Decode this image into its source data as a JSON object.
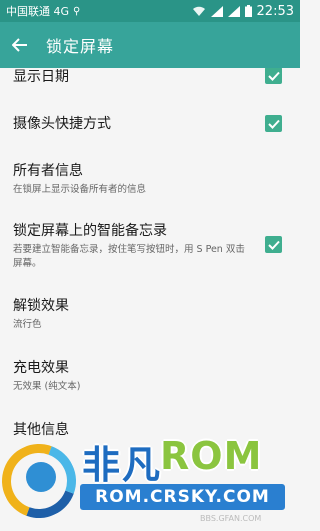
{
  "status_bar": {
    "carrier": "中国联通 4G",
    "usb_icon": "usb-icon",
    "time": "22:53"
  },
  "app_bar": {
    "title": "锁定屏幕",
    "back_icon": "arrow-left-icon"
  },
  "settings": [
    {
      "title": "显示日期",
      "subtitle": "",
      "checked": true
    },
    {
      "title": "摄像头快捷方式",
      "subtitle": "",
      "checked": true
    },
    {
      "title": "所有者信息",
      "subtitle": "在锁屏上显示设备所有者的信息",
      "checked": null
    },
    {
      "title": "锁定屏幕上的智能备忘录",
      "subtitle": "若要建立智能备忘录，按住笔写按钮时，用 S Pen 双击屏幕。",
      "checked": true
    },
    {
      "title": "解锁效果",
      "subtitle": "流行色",
      "checked": null
    },
    {
      "title": "充电效果",
      "subtitle": "无效果 (纯文本)",
      "checked": null
    },
    {
      "title": "其他信息",
      "subtitle": "",
      "checked": null
    }
  ],
  "watermark": {
    "brand_cn": "非凡",
    "brand_rom": "ROM",
    "domain": "ROM.CRSKY.COM",
    "small": "BBS.GFAN.COM"
  },
  "colors": {
    "status_bar": "#2a9487",
    "app_bar": "#37a49a",
    "checkbox": "#3fae8f",
    "background": "#f5f5f5"
  }
}
